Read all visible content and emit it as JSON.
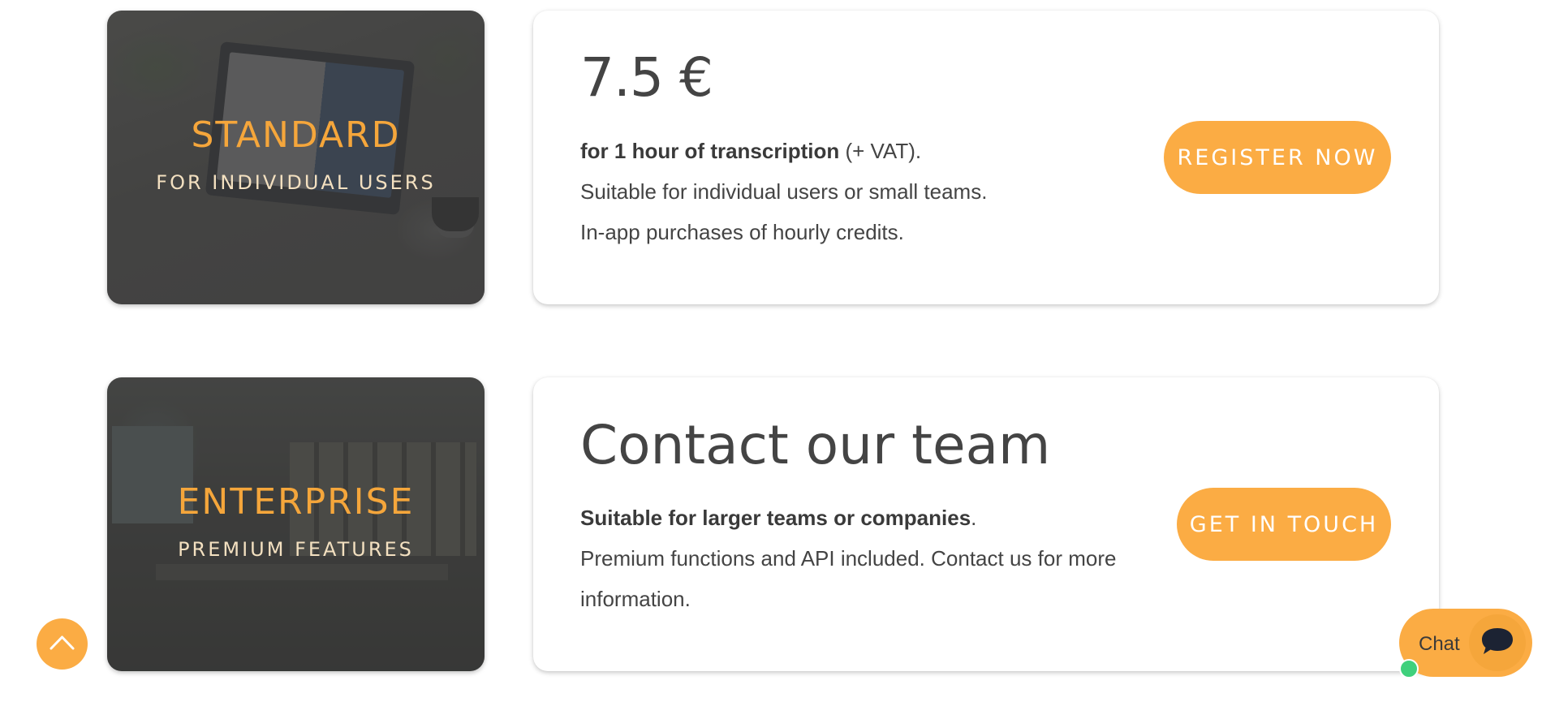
{
  "plans": {
    "standard": {
      "name": "STANDARD",
      "subtitle": "FOR INDIVIDUAL USERS",
      "price": "7.5 €",
      "desc_bold": "for 1 hour of transcription",
      "desc_rest": " (+ VAT).",
      "line2": "Suitable for individual users or small teams.",
      "line3": "In-app purchases of hourly credits.",
      "cta": "REGISTER NOW"
    },
    "enterprise": {
      "name": "ENTERPRISE",
      "subtitle": "PREMIUM FEATURES",
      "headline": "Contact our team",
      "desc_bold": "Suitable for larger teams or companies",
      "desc_rest": ".",
      "line2": "Premium functions and API included. Contact us for more information.",
      "cta": "GET IN TOUCH"
    }
  },
  "chat": {
    "label": "Chat"
  },
  "icons": {
    "scroll_top": "chevron-up-icon",
    "chat": "chat-bubble-icon"
  },
  "colors": {
    "accent": "#fbac44",
    "text": "#444444",
    "online": "#3fd07c"
  }
}
